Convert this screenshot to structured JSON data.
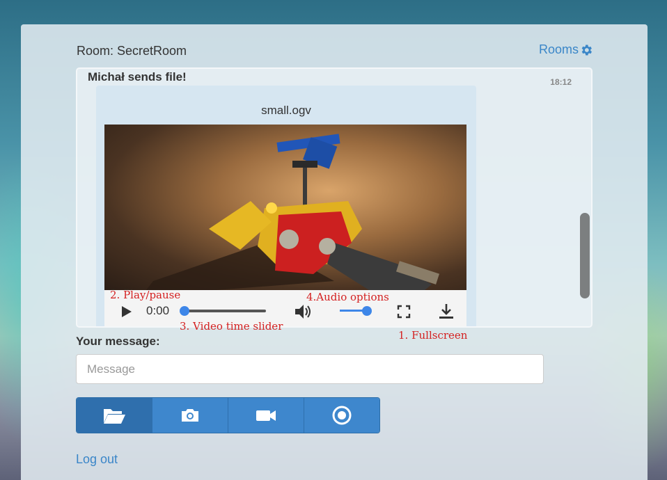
{
  "header": {
    "room_title": "Room: SecretRoom",
    "rooms_label": "Rooms"
  },
  "message": {
    "sender_text": "Michał sends file!",
    "time": "18:12",
    "file_name": "small.ogv",
    "player": {
      "current_time": "0:00",
      "progress_fraction": 0,
      "volume_fraction": 1.0
    }
  },
  "annotations": {
    "play_pause": "2. Play/pause",
    "time_slider": "3. Video time slider",
    "audio_options": "4.Audio options",
    "fullscreen": "1. Fullscreen"
  },
  "composer": {
    "label": "Your message:",
    "placeholder": "Message",
    "value": ""
  },
  "actions": {
    "buttons": [
      {
        "icon": "folder-open-icon",
        "active": true
      },
      {
        "icon": "camera-icon",
        "active": false
      },
      {
        "icon": "video-camera-icon",
        "active": false
      },
      {
        "icon": "record-icon",
        "active": false
      }
    ]
  },
  "footer": {
    "logout_label": "Log out"
  },
  "colors": {
    "accent": "#3e87cd",
    "accent_dark": "#2f6fad",
    "link": "#3a86c8",
    "slider": "#3d86e8",
    "annotation": "#d42020"
  }
}
